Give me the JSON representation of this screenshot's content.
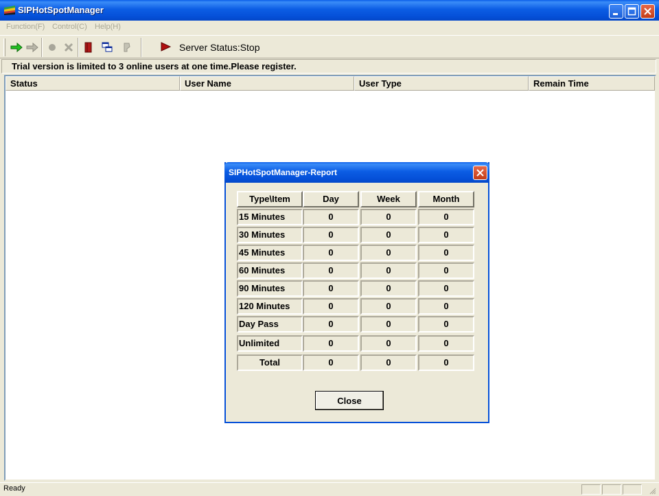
{
  "window": {
    "title": "SIPHotSpotManager"
  },
  "menu": {
    "items": [
      "Function(F)",
      "Control(C)",
      "Help(H)"
    ]
  },
  "toolbar": {
    "server_status": "Server Status:Stop"
  },
  "trial_notice": "Trial version is limited to 3 online users at one time.Please register.",
  "list": {
    "columns": [
      "Status",
      "User Name",
      "User Type",
      "Remain Time"
    ]
  },
  "statusbar": {
    "text": "Ready"
  },
  "report_dialog": {
    "title": "SIPHotSpotManager-Report",
    "headers": [
      "Type\\Item",
      "Day",
      "Week",
      "Month"
    ],
    "rows": [
      {
        "label": "15 Minutes",
        "day": "0",
        "week": "0",
        "month": "0"
      },
      {
        "label": "30 Minutes",
        "day": "0",
        "week": "0",
        "month": "0"
      },
      {
        "label": "45 Minutes",
        "day": "0",
        "week": "0",
        "month": "0"
      },
      {
        "label": "60 Minutes",
        "day": "0",
        "week": "0",
        "month": "0"
      },
      {
        "label": "90 Minutes",
        "day": "0",
        "week": "0",
        "month": "0"
      },
      {
        "label": "120 Minutes",
        "day": "0",
        "week": "0",
        "month": "0"
      },
      {
        "label": "Day Pass",
        "day": "0",
        "week": "0",
        "month": "0"
      },
      {
        "label": "Unlimited",
        "day": "0",
        "week": "0",
        "month": "0"
      },
      {
        "label": "Total",
        "day": "0",
        "week": "0",
        "month": "0"
      }
    ],
    "close_label": "Close"
  },
  "colors": {
    "title_blue": "#0550D8",
    "face": "#ECE9D8",
    "close_red": "#C43D17",
    "menu_disabled": "#A9A794"
  }
}
